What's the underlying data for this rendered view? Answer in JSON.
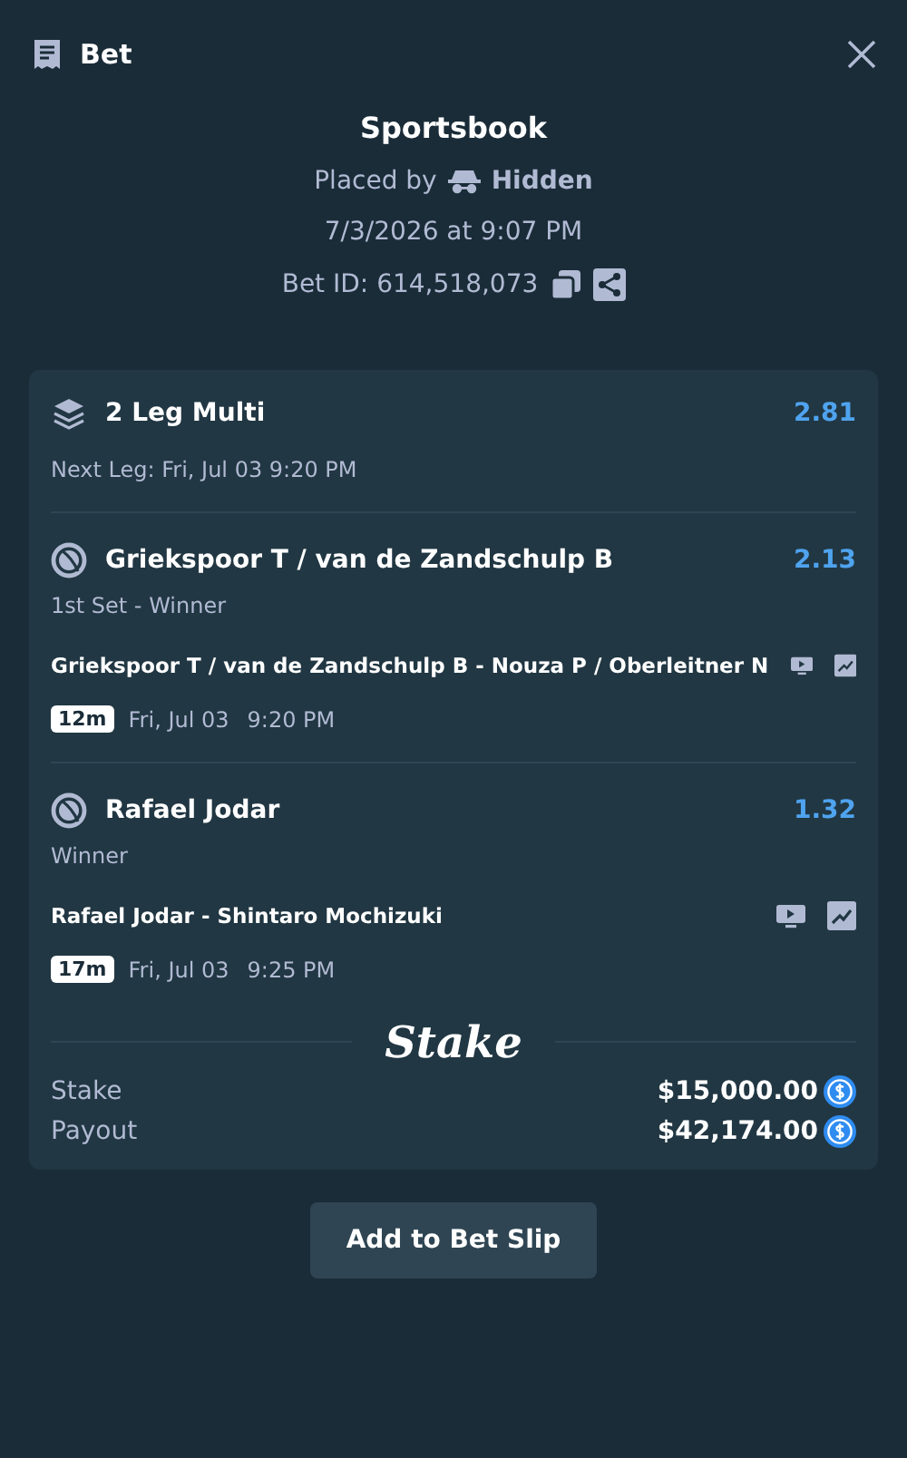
{
  "header": {
    "title": "Bet"
  },
  "title": "Sportsbook",
  "placed_by": {
    "label": "Placed by",
    "user": "Hidden"
  },
  "placed_at": "7/3/2026 at 9:07 PM",
  "bet_id": "Bet ID: 614,518,073",
  "multi": {
    "title": "2 Leg Multi",
    "odds": "2.81",
    "next_leg": "Next Leg: Fri, Jul 03 9:20 PM"
  },
  "legs": [
    {
      "selection": "Griekspoor T / van de Zandschulp B",
      "odds": "2.13",
      "market": "1st Set - Winner",
      "event": "Griekspoor T / van de Zandschulp B - Nouza P / Oberleitner N",
      "countdown": "12m",
      "date": "Fri, Jul 03",
      "time": "9:20 PM"
    },
    {
      "selection": "Rafael Jodar",
      "odds": "1.32",
      "market": "Winner",
      "event": "Rafael Jodar - Shintaro Mochizuki",
      "countdown": "17m",
      "date": "Fri, Jul 03",
      "time": "9:25 PM"
    }
  ],
  "logo": "Stake",
  "totals": [
    {
      "label": "Stake",
      "amount": "$15,000.00"
    },
    {
      "label": "Payout",
      "amount": "$42,174.00"
    }
  ],
  "action": "Add to Bet Slip"
}
